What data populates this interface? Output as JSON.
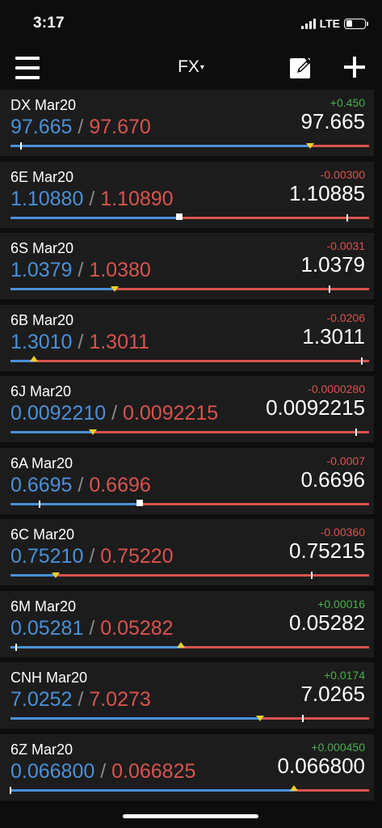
{
  "status_bar": {
    "time": "3:17",
    "network": "LTE",
    "battery_level": 0.35
  },
  "nav": {
    "title": "FX",
    "caret": "▾",
    "menu_icon": "hamburger-menu-icon",
    "edit_icon": "edit-icon",
    "add_icon": "plus-icon"
  },
  "colors": {
    "bid": "#4a90d9",
    "ask": "#d9534f",
    "positive": "#4caf50",
    "negative": "#d9534f",
    "marker": "#e8d22a",
    "row_bg": "#1c1c1c",
    "background": "#0d0d0d"
  },
  "quotes": [
    {
      "symbol": "DX Mar20",
      "bid": "97.665",
      "ask": "97.670",
      "change": "+0.450",
      "direction": "up",
      "last": "97.665",
      "split": 0.84,
      "marker": "triangle-down",
      "marker_pos": 0.835,
      "tick_pos": 0.03
    },
    {
      "symbol": "6E Mar20",
      "bid": "1.10880",
      "ask": "1.10890",
      "change": "-0.00300",
      "direction": "down",
      "last": "1.10885",
      "split": 0.47,
      "marker": "square",
      "marker_pos": 0.47,
      "tick_pos": 0.94
    },
    {
      "symbol": "6S Mar20",
      "bid": "1.0379",
      "ask": "1.0380",
      "change": "-0.0031",
      "direction": "down",
      "last": "1.0379",
      "split": 0.29,
      "marker": "triangle-down",
      "marker_pos": 0.29,
      "tick_pos": 0.89
    },
    {
      "symbol": "6B Mar20",
      "bid": "1.3010",
      "ask": "1.3011",
      "change": "-0.0206",
      "direction": "down",
      "last": "1.3011",
      "split": 0.065,
      "marker": "triangle-up",
      "marker_pos": 0.065,
      "tick_pos": 0.98
    },
    {
      "symbol": "6J Mar20",
      "bid": "0.0092210",
      "ask": "0.0092215",
      "change": "-0.0000280",
      "direction": "down",
      "last": "0.0092215",
      "split": 0.23,
      "marker": "triangle-down",
      "marker_pos": 0.23,
      "tick_pos": 0.965
    },
    {
      "symbol": "6A Mar20",
      "bid": "0.6695",
      "ask": "0.6696",
      "change": "-0.0007",
      "direction": "down",
      "last": "0.6696",
      "split": 0.36,
      "marker": "square",
      "marker_pos": 0.36,
      "tick_pos": 0.08
    },
    {
      "symbol": "6C Mar20",
      "bid": "0.75210",
      "ask": "0.75220",
      "change": "-0.00360",
      "direction": "down",
      "last": "0.75215",
      "split": 0.125,
      "marker": "triangle-down",
      "marker_pos": 0.125,
      "tick_pos": 0.84
    },
    {
      "symbol": "6M Mar20",
      "bid": "0.05281",
      "ask": "0.05282",
      "change": "+0.00016",
      "direction": "up",
      "last": "0.05282",
      "split": 0.475,
      "marker": "triangle-up",
      "marker_pos": 0.475,
      "tick_pos": 0.015
    },
    {
      "symbol": "CNH Mar20",
      "bid": "7.0252",
      "ask": "7.0273",
      "change": "+0.0174",
      "direction": "up",
      "last": "7.0265",
      "split": 0.7,
      "marker": "triangle-down",
      "marker_pos": 0.695,
      "tick_pos": 0.815
    },
    {
      "symbol": "6Z Mar20",
      "bid": "0.066800",
      "ask": "0.066825",
      "change": "+0.000450",
      "direction": "up",
      "last": "0.066800",
      "split": 0.79,
      "marker": "triangle-up",
      "marker_pos": 0.79,
      "tick_pos": 0.0
    }
  ]
}
